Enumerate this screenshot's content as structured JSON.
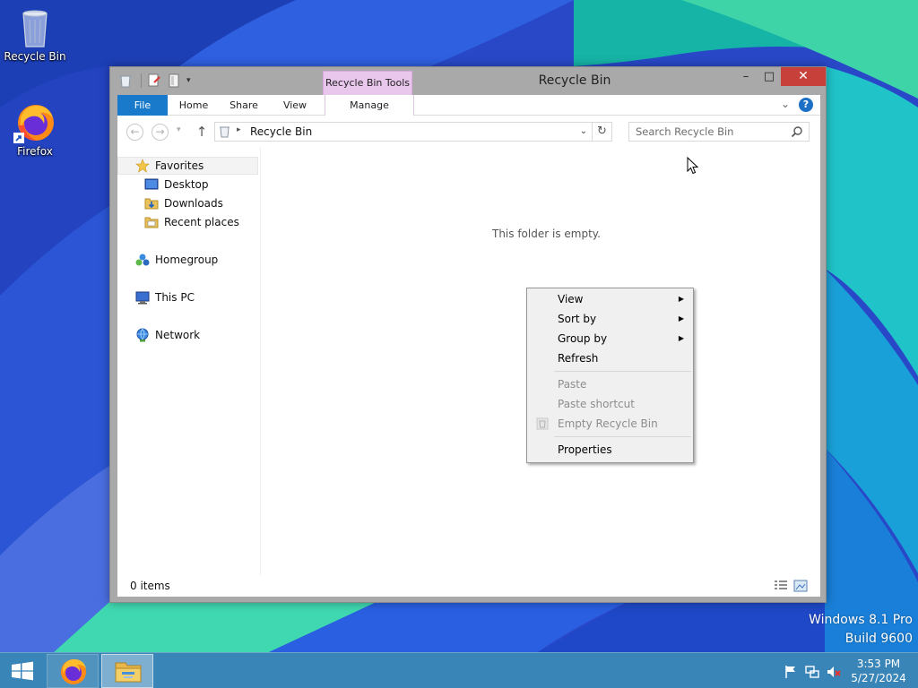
{
  "desktop": {
    "icons": [
      {
        "label": "Recycle Bin",
        "icon": "recycle-bin-icon"
      },
      {
        "label": "Firefox",
        "icon": "firefox-icon"
      }
    ],
    "watermark": {
      "line1": "Windows 8.1 Pro",
      "line2": "Build 9600"
    }
  },
  "window": {
    "title": "Recycle Bin",
    "contextual_tab_group": "Recycle Bin Tools",
    "controls": {
      "minimize": "–",
      "maximize": "□",
      "close": "✕"
    },
    "ribbon_tabs": {
      "file": "File",
      "home": "Home",
      "share": "Share",
      "view": "View",
      "manage": "Manage"
    },
    "address": {
      "path": "Recycle Bin"
    },
    "search": {
      "placeholder": "Search Recycle Bin"
    },
    "nav_pane": {
      "favorites": "Favorites",
      "favorites_items": [
        "Desktop",
        "Downloads",
        "Recent places"
      ],
      "homegroup": "Homegroup",
      "this_pc": "This PC",
      "network": "Network"
    },
    "empty_message": "This folder is empty.",
    "status": {
      "item_count": "0 items"
    }
  },
  "context_menu": {
    "items": [
      {
        "label": "View",
        "submenu": true,
        "enabled": true
      },
      {
        "label": "Sort by",
        "submenu": true,
        "enabled": true
      },
      {
        "label": "Group by",
        "submenu": true,
        "enabled": true
      },
      {
        "label": "Refresh",
        "submenu": false,
        "enabled": true
      },
      {
        "label": "Paste",
        "submenu": false,
        "enabled": false
      },
      {
        "label": "Paste shortcut",
        "submenu": false,
        "enabled": false
      },
      {
        "label": "Empty Recycle Bin",
        "submenu": false,
        "enabled": false
      },
      {
        "label": "Properties",
        "submenu": false,
        "enabled": true
      }
    ]
  },
  "taskbar": {
    "apps": [
      "firefox-icon",
      "file-explorer-icon"
    ],
    "clock": {
      "time": "3:53 PM",
      "date": "5/27/2024"
    },
    "tray": [
      "action-center-flag-icon",
      "network-icon",
      "volume-muted-icon"
    ]
  },
  "colors": {
    "file_tab": "#1979ca",
    "contextual_tab": "#e9c6ec",
    "close_button": "#c7403a",
    "taskbar": "#4096b2"
  }
}
